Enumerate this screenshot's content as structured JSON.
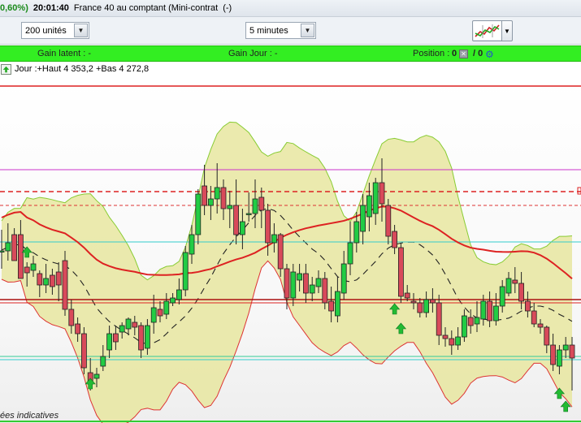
{
  "titlebar": {
    "pct": "0,60%)",
    "time": "20:01:40",
    "instrument": "France 40 au comptant (Mini-contrat",
    "instrument_suffix": "(-)"
  },
  "toolbar": {
    "units_select": "200 unités",
    "period_select": "5 minutes"
  },
  "greenbar": {
    "gain_latent": "Gain latent :  -",
    "gain_jour": "Gain Jour :  -",
    "position_label": "Position :",
    "position_value": "0",
    "position_sep": "/ 0"
  },
  "infobar": {
    "text": "Jour :+Haut 4 353,2 +Bas 4 272,8"
  },
  "footer": {
    "text": "ées indicatives"
  },
  "chart_data": {
    "type": "candlestick",
    "candles": [
      [
        212,
        212,
        190,
        238
      ],
      [
        212,
        222,
        200,
        246
      ],
      [
        232,
        200,
        225,
        240
      ],
      [
        232,
        178,
        230,
        250
      ],
      [
        192,
        185,
        168,
        198
      ],
      [
        188,
        196,
        180,
        206
      ],
      [
        184,
        170,
        155,
        188
      ],
      [
        170,
        178,
        160,
        196
      ],
      [
        182,
        168,
        158,
        190
      ],
      [
        186,
        170,
        150,
        198
      ],
      [
        200,
        140,
        132,
        212
      ],
      [
        140,
        120,
        110,
        152
      ],
      [
        122,
        110,
        100,
        130
      ],
      [
        110,
        68,
        60,
        118
      ],
      [
        62,
        48,
        40,
        80
      ],
      [
        55,
        60,
        44,
        68
      ],
      [
        70,
        82,
        64,
        96
      ],
      [
        90,
        110,
        80,
        120
      ],
      [
        110,
        100,
        90,
        120
      ],
      [
        112,
        120,
        104,
        124
      ],
      [
        116,
        128,
        108,
        130
      ],
      [
        124,
        118,
        108,
        132
      ],
      [
        120,
        90,
        80,
        124
      ],
      [
        92,
        120,
        84,
        128
      ],
      [
        124,
        142,
        110,
        158
      ],
      [
        140,
        132,
        124,
        150
      ],
      [
        134,
        150,
        128,
        160
      ],
      [
        148,
        154,
        144,
        160
      ],
      [
        152,
        164,
        146,
        178
      ],
      [
        164,
        210,
        156,
        218
      ],
      [
        208,
        232,
        196,
        244
      ],
      [
        232,
        282,
        220,
        288
      ],
      [
        292,
        268,
        256,
        318
      ],
      [
        268,
        276,
        250,
        292
      ],
      [
        276,
        290,
        258,
        320
      ],
      [
        290,
        264,
        250,
        300
      ],
      [
        264,
        268,
        240,
        286
      ],
      [
        268,
        232,
        220,
        300
      ],
      [
        232,
        248,
        214,
        264
      ],
      [
        258,
        258,
        248,
        284
      ],
      [
        258,
        276,
        240,
        300
      ],
      [
        278,
        262,
        240,
        290
      ],
      [
        262,
        222,
        206,
        270
      ],
      [
        222,
        232,
        210,
        246
      ],
      [
        232,
        190,
        180,
        234
      ],
      [
        190,
        154,
        140,
        196
      ],
      [
        154,
        186,
        144,
        196
      ],
      [
        176,
        184,
        162,
        196
      ],
      [
        184,
        160,
        148,
        196
      ],
      [
        160,
        170,
        150,
        180
      ],
      [
        168,
        178,
        160,
        188
      ],
      [
        178,
        148,
        140,
        186
      ],
      [
        150,
        138,
        124,
        168
      ],
      [
        132,
        162,
        124,
        180
      ],
      [
        160,
        196,
        152,
        212
      ],
      [
        196,
        222,
        182,
        248
      ],
      [
        222,
        248,
        210,
        260
      ],
      [
        236,
        268,
        220,
        282
      ],
      [
        254,
        280,
        236,
        296
      ],
      [
        258,
        296,
        244,
        302
      ],
      [
        296,
        270,
        248,
        326
      ],
      [
        268,
        230,
        220,
        276
      ],
      [
        236,
        216,
        208,
        244
      ],
      [
        216,
        156,
        148,
        222
      ],
      [
        160,
        154,
        150,
        170
      ],
      [
        150,
        148,
        140,
        160
      ],
      [
        148,
        136,
        130,
        154
      ],
      [
        136,
        152,
        130,
        162
      ],
      [
        152,
        148,
        136,
        166
      ],
      [
        148,
        108,
        96,
        158
      ],
      [
        108,
        104,
        94,
        118
      ],
      [
        104,
        96,
        84,
        114
      ],
      [
        96,
        106,
        90,
        118
      ],
      [
        106,
        132,
        100,
        140
      ],
      [
        130,
        120,
        110,
        140
      ],
      [
        122,
        130,
        112,
        150
      ],
      [
        128,
        150,
        120,
        158
      ],
      [
        150,
        126,
        118,
        162
      ],
      [
        126,
        144,
        120,
        160
      ],
      [
        144,
        168,
        136,
        176
      ],
      [
        160,
        178,
        156,
        186
      ],
      [
        176,
        172,
        160,
        192
      ],
      [
        172,
        150,
        140,
        186
      ],
      [
        150,
        138,
        130,
        162
      ],
      [
        138,
        122,
        118,
        148
      ],
      [
        122,
        118,
        110,
        128
      ],
      [
        118,
        96,
        86,
        120
      ],
      [
        96,
        72,
        64,
        110
      ],
      [
        70,
        90,
        60,
        96
      ],
      [
        90,
        96,
        80,
        106
      ],
      [
        96,
        80,
        40,
        106
      ]
    ],
    "price_lines": [
      "4 353,2",
      "4 272,8"
    ],
    "signals": [
      "up-arrow"
    ]
  }
}
